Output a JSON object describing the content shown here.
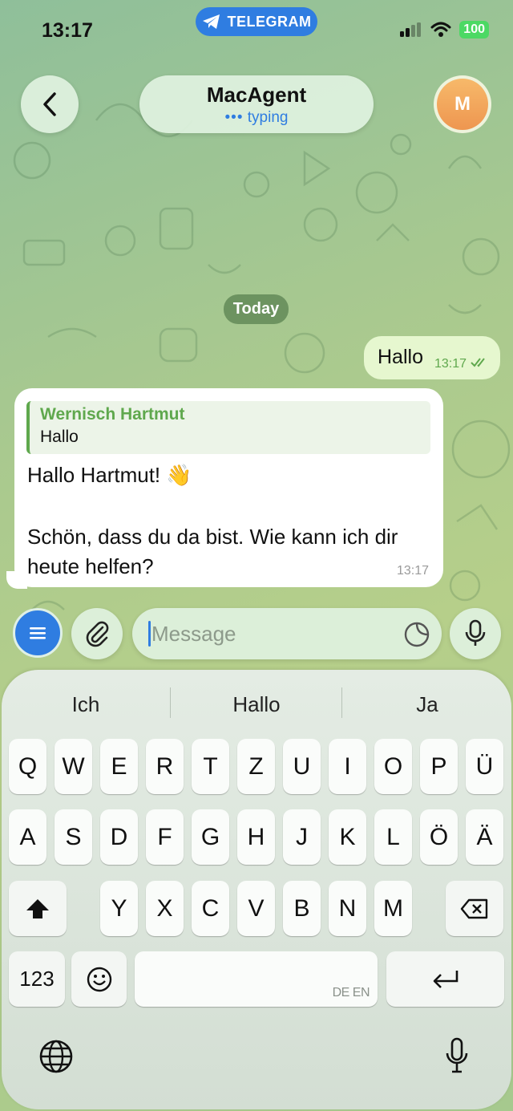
{
  "status_bar": {
    "time": "13:17",
    "app_name": "TELEGRAM",
    "battery": "100"
  },
  "header": {
    "title": "MacAgent",
    "subtitle": "typing",
    "avatar_letter": "M"
  },
  "chat": {
    "date_label": "Today",
    "outgoing": {
      "text": "Hallo",
      "time": "13:17"
    },
    "incoming": {
      "reply_name": "Wernisch Hartmut",
      "reply_text": "Hallo",
      "line1": "Hallo Hartmut! 👋",
      "line2": "Schön, dass du da bist. Wie kann ich dir heute helfen?",
      "time": "13:17"
    }
  },
  "input": {
    "placeholder": "Message"
  },
  "keyboard": {
    "suggestions": [
      "Ich",
      "Hallo",
      "Ja"
    ],
    "row1": [
      "Q",
      "W",
      "E",
      "R",
      "T",
      "Z",
      "U",
      "I",
      "O",
      "P",
      "Ü"
    ],
    "row2": [
      "A",
      "S",
      "D",
      "F",
      "G",
      "H",
      "J",
      "K",
      "L",
      "Ö",
      "Ä"
    ],
    "row3": [
      "Y",
      "X",
      "C",
      "V",
      "B",
      "N",
      "M"
    ],
    "numbers_label": "123",
    "space_lang": "DE EN"
  },
  "colors": {
    "accent": "#2f7de1",
    "reply_green": "#5fa84d",
    "outgoing_bubble": "#e6f7cf"
  }
}
